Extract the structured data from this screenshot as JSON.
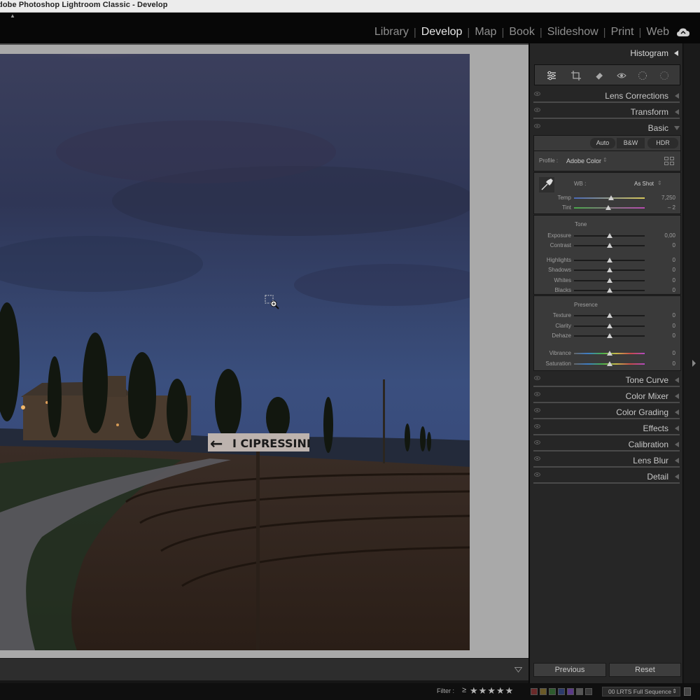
{
  "window": {
    "title": "dobe Photoshop Lightroom Classic - Develop"
  },
  "modules": [
    {
      "label": "Library",
      "active": false
    },
    {
      "label": "Develop",
      "active": true
    },
    {
      "label": "Map",
      "active": false
    },
    {
      "label": "Book",
      "active": false
    },
    {
      "label": "Slideshow",
      "active": false
    },
    {
      "label": "Print",
      "active": false
    },
    {
      "label": "Web",
      "active": false
    }
  ],
  "separator": "|",
  "photo": {
    "sign_text": "I CIPRESSINI",
    "sign_arrow": "←"
  },
  "panel": {
    "histogram_label": "Histogram",
    "tools": [
      "edit-sliders-icon",
      "crop-icon",
      "healing-eraser-icon",
      "red-eye-icon",
      "masking-icon",
      "presets-icon"
    ],
    "sections_above": [
      "Lens Corrections",
      "Transform"
    ],
    "basic": {
      "label": "Basic",
      "treatment_buttons": [
        "Auto",
        "B&W",
        "HDR"
      ],
      "profile_label": "Profile :",
      "profile_value": "Adobe Color",
      "wb_label": "WB :",
      "wb_value": "As Shot",
      "tone_label": "Tone",
      "presence_label": "Presence",
      "temp": {
        "name": "Temp",
        "value": "7,250",
        "position": 0.52
      },
      "tint": {
        "name": "Tint",
        "value": "– 2",
        "position": 0.49
      },
      "exposure": {
        "name": "Exposure",
        "value": "0,00",
        "position": 0.5
      },
      "contrast": {
        "name": "Contrast",
        "value": "0",
        "position": 0.5
      },
      "highlights": {
        "name": "Highlights",
        "value": "0",
        "position": 0.5
      },
      "shadows": {
        "name": "Shadows",
        "value": "0",
        "position": 0.5
      },
      "whites": {
        "name": "Whites",
        "value": "0",
        "position": 0.5
      },
      "blacks": {
        "name": "Blacks",
        "value": "0",
        "position": 0.5
      },
      "texture": {
        "name": "Texture",
        "value": "0",
        "position": 0.5
      },
      "clarity": {
        "name": "Clarity",
        "value": "0",
        "position": 0.5
      },
      "dehaze": {
        "name": "Dehaze",
        "value": "0",
        "position": 0.5
      },
      "vibrance": {
        "name": "Vibrance",
        "value": "0",
        "position": 0.5
      },
      "saturation": {
        "name": "Saturation",
        "value": "0",
        "position": 0.5
      }
    },
    "sections_below": [
      "Tone Curve",
      "Color Mixer",
      "Color Grading",
      "Effects",
      "Calibration",
      "Lens Blur",
      "Detail"
    ],
    "previous_label": "Previous",
    "reset_label": "Reset"
  },
  "statusbar": {
    "filter_label": "Filter :",
    "rating_operator": "≥",
    "stars": "★★★★★",
    "color_labels": [
      "#6a2a2a",
      "#6a5a28",
      "#2e5a2e",
      "#2c3a6a",
      "#5a3a86",
      "#555555",
      "#3a3a3a"
    ],
    "collection": "00 LRTS Full Sequence",
    "collection_arrow": "⇕"
  },
  "colors": {
    "accent_text": "#e6e6e6",
    "panel_bg": "#262626",
    "section_bg": "#3a3a3a"
  }
}
